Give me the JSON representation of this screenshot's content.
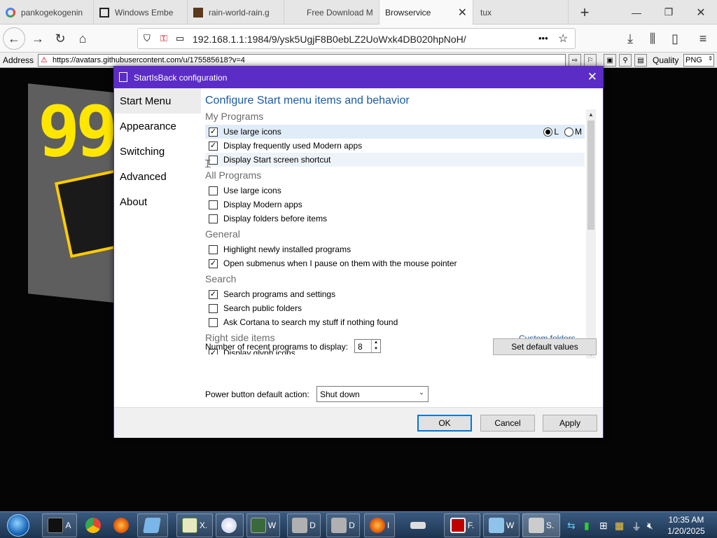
{
  "browser": {
    "tabs": [
      {
        "title": "pankogekogenin",
        "active": false
      },
      {
        "title": "Windows Embe",
        "active": false
      },
      {
        "title": "rain-world-rain.g",
        "active": false
      },
      {
        "title": "Free Download M",
        "active": false
      },
      {
        "title": "Browservice",
        "active": true
      },
      {
        "title": "tux",
        "active": false
      }
    ],
    "new_tab_label": "+",
    "url": "192.168.1.1:1984/9/ysk5UgjF8B0ebLZ2UoWxk4DB020hpNoH/",
    "page_actions_label": "•••"
  },
  "browservice": {
    "address_label": "Address",
    "address_url": "https://avatars.githubusercontent.com/u/175585618?v=4",
    "quality_label": "Quality",
    "quality_value": "PNG"
  },
  "background": {
    "art_text": "99"
  },
  "dialog": {
    "title": "StartIsBack configuration",
    "sidebar": [
      {
        "label": "Start Menu",
        "selected": true
      },
      {
        "label": "Appearance",
        "selected": false
      },
      {
        "label": "Switching",
        "selected": false
      },
      {
        "label": "Advanced",
        "selected": false
      },
      {
        "label": "About",
        "selected": false
      }
    ],
    "heading": "Configure Start menu items and behavior",
    "sections": {
      "my_programs": "My Programs",
      "all_programs": "All Programs",
      "general": "General",
      "search": "Search",
      "right_side": "Right side items"
    },
    "options": {
      "use_large_icons_my": {
        "label": "Use large icons",
        "checked": true
      },
      "frequent_modern": {
        "label": "Display frequently used Modern apps",
        "checked": true
      },
      "start_screen_shortcut": {
        "label": "Display Start screen shortcut",
        "checked": false
      },
      "use_large_icons_all": {
        "label": "Use large icons",
        "checked": false
      },
      "display_modern": {
        "label": "Display Modern apps",
        "checked": false
      },
      "folders_before": {
        "label": "Display folders before items",
        "checked": false
      },
      "highlight_new": {
        "label": "Highlight newly installed programs",
        "checked": false
      },
      "open_submenus": {
        "label": "Open submenus when I pause on them with the mouse pointer",
        "checked": true
      },
      "search_programs": {
        "label": "Search programs and settings",
        "checked": true
      },
      "search_public": {
        "label": "Search public folders",
        "checked": false
      },
      "ask_cortana": {
        "label": "Ask Cortana to search my stuff if nothing found",
        "checked": false
      },
      "glyph_icons": {
        "label": "Display glyph icons",
        "checked": true
      }
    },
    "icon_size_radios": [
      {
        "label": "L",
        "checked": true
      },
      {
        "label": "M",
        "checked": false
      }
    ],
    "custom_folders_link": "Custom folders...",
    "recent_programs_label": "Number of recent programs to display:",
    "recent_programs_value": "8",
    "set_default_label": "Set default values",
    "power_button_label": "Power button default action:",
    "power_button_value": "Shut down",
    "ok_label": "OK",
    "cancel_label": "Cancel",
    "apply_label": "Apply"
  },
  "taskbar": {
    "items": [
      {
        "label": "A",
        "icon": "terminal-icon"
      },
      {
        "label": "",
        "icon": "chrome-icon"
      },
      {
        "label": "",
        "icon": "firefox-icon"
      },
      {
        "label": "",
        "icon": "explorer-icon"
      },
      {
        "label": "X.",
        "icon": "spreadsheet-icon"
      },
      {
        "label": "",
        "icon": "paint-icon"
      },
      {
        "label": "W",
        "icon": "network-icon"
      },
      {
        "label": "D",
        "icon": "drive-icon"
      },
      {
        "label": "D",
        "icon": "drive-icon"
      },
      {
        "label": "I",
        "icon": "firefox-icon"
      },
      {
        "label": "",
        "icon": "scanner-icon"
      },
      {
        "label": "F.",
        "icon": "filezilla-icon"
      },
      {
        "label": "W",
        "icon": "document-icon"
      },
      {
        "label": "S.",
        "icon": "settings-app-icon"
      }
    ],
    "time": "10:35 AM",
    "date": "1/20/2025"
  }
}
